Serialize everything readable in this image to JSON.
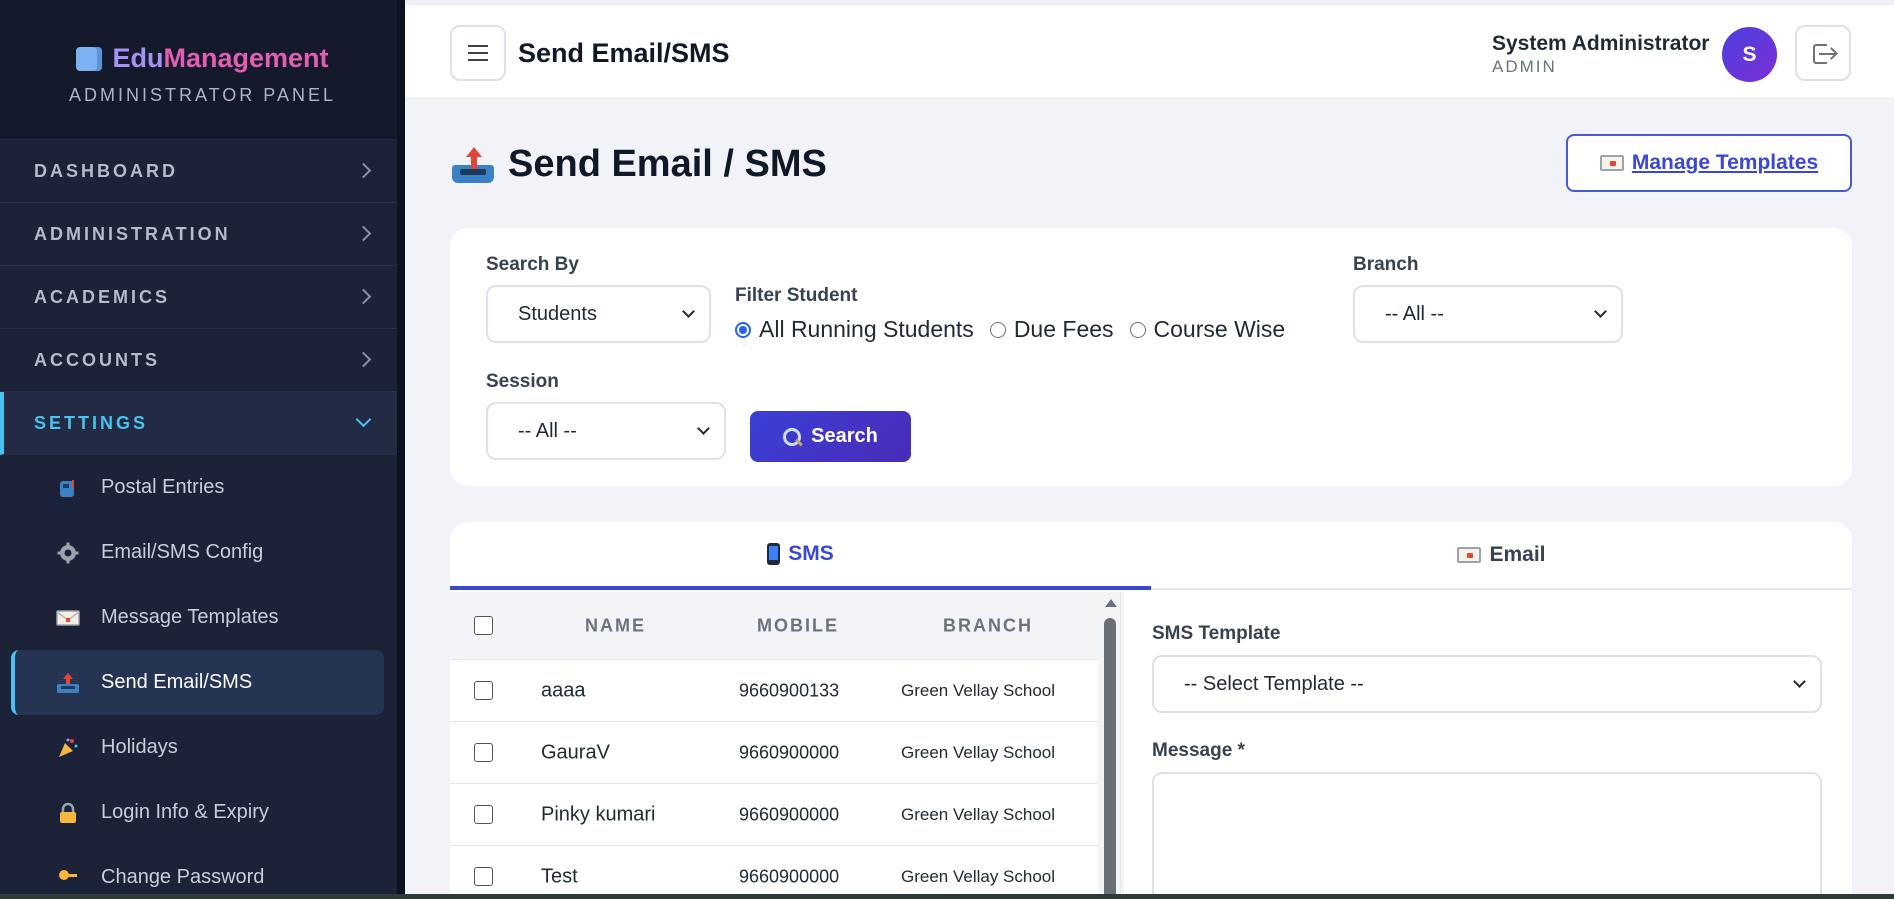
{
  "brand": {
    "name_start": "Edu",
    "name_end": "Management",
    "subtitle": "ADMINISTRATOR PANEL"
  },
  "sidebar": {
    "sections": [
      {
        "label": "DASHBOARD"
      },
      {
        "label": "ADMINISTRATION"
      },
      {
        "label": "ACADEMICS"
      },
      {
        "label": "ACCOUNTS"
      },
      {
        "label": "SETTINGS"
      }
    ],
    "items": [
      {
        "label": "Postal Entries",
        "icon": "mailbox-icon"
      },
      {
        "label": "Email/SMS Config",
        "icon": "gear-icon"
      },
      {
        "label": "Message Templates",
        "icon": "envelope-icon"
      },
      {
        "label": "Send Email/SMS",
        "icon": "outbox-tray-icon"
      },
      {
        "label": "Holidays",
        "icon": "party-popper-icon"
      },
      {
        "label": "Login Info & Expiry",
        "icon": "lock-icon"
      },
      {
        "label": "Change Password",
        "icon": "key-icon"
      }
    ]
  },
  "header": {
    "title": "Send Email/SMS",
    "user_name": "System Administrator",
    "user_role": "ADMIN",
    "avatar_initial": "S"
  },
  "main": {
    "title": "Send Email / SMS",
    "manage_templates": "Manage Templates",
    "filters": {
      "search_by_label": "Search By",
      "search_by_value": "Students",
      "filter_student_label": "Filter Student",
      "radio_options": [
        "All Running Students",
        "Due Fees",
        "Course Wise"
      ],
      "branch_label": "Branch",
      "branch_value": "-- All --",
      "session_label": "Session",
      "session_value": "-- All --",
      "search_button": "Search"
    },
    "tabs": {
      "sms": "SMS",
      "email": "Email"
    },
    "table": {
      "headers": [
        "NAME",
        "MOBILE",
        "BRANCH"
      ],
      "rows": [
        {
          "name": "aaaa",
          "mobile": "9660900133",
          "branch": "Green Vellay School"
        },
        {
          "name": "GauraV",
          "mobile": "9660900000",
          "branch": "Green Vellay School"
        },
        {
          "name": "Pinky kumari",
          "mobile": "9660900000",
          "branch": "Green Vellay School"
        },
        {
          "name": "Test",
          "mobile": "9660900000",
          "branch": "Green Vellay School"
        }
      ]
    },
    "sms": {
      "template_label": "SMS Template",
      "template_value": "-- Select Template --",
      "message_label": "Message *"
    }
  },
  "colors": {
    "accent": "#3a47cf",
    "sidebar_bg": "#1c2238",
    "sidebar_active": "#47c3ee"
  }
}
